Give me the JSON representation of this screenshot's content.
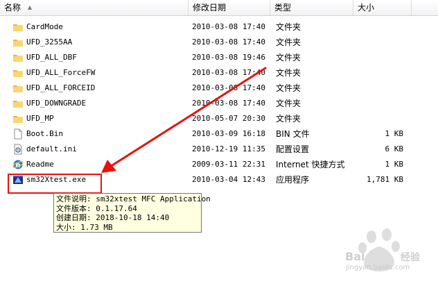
{
  "columns": {
    "name": "名称",
    "date": "修改日期",
    "type": "类型",
    "size": "大小"
  },
  "files": [
    {
      "name": "CardMode",
      "date": "2010-03-08 17:40",
      "type": "文件夹",
      "size": "",
      "icon": "folder"
    },
    {
      "name": "UFD_3255AA",
      "date": "2010-03-08 17:40",
      "type": "文件夹",
      "size": "",
      "icon": "folder"
    },
    {
      "name": "UFD_ALL_DBF",
      "date": "2010-03-08 19:46",
      "type": "文件夹",
      "size": "",
      "icon": "folder"
    },
    {
      "name": "UFD_ALL_ForceFW",
      "date": "2010-03-08 17:40",
      "type": "文件夹",
      "size": "",
      "icon": "folder"
    },
    {
      "name": "UFD_ALL_FORCEID",
      "date": "2010-03-08 17:40",
      "type": "文件夹",
      "size": "",
      "icon": "folder"
    },
    {
      "name": "UFD_DOWNGRADE",
      "date": "2010-03-08 17:40",
      "type": "文件夹",
      "size": "",
      "icon": "folder"
    },
    {
      "name": "UFD_MP",
      "date": "2010-05-07 20:30",
      "type": "文件夹",
      "size": "",
      "icon": "folder"
    },
    {
      "name": "Boot.Bin",
      "date": "2010-03-09 16:18",
      "type": "BIN 文件",
      "size": "1 KB",
      "icon": "file"
    },
    {
      "name": "default.ini",
      "date": "2010-12-19 11:35",
      "type": "配置设置",
      "size": "6 KB",
      "icon": "ini"
    },
    {
      "name": "Readme",
      "date": "2009-03-11 22:31",
      "type": "Internet 快捷方式",
      "size": "1 KB",
      "icon": "ie"
    },
    {
      "name": "sm32Xtest.exe",
      "date": "2010-03-04 12:43",
      "type": "应用程序",
      "size": "1,781 KB",
      "icon": "exe"
    }
  ],
  "tooltip": {
    "line1": "文件说明: sm32xtest MFC Application",
    "line2": "文件版本: 0.1.17.64",
    "line3": "创建日期: 2018-10-18 14:40",
    "line4": "大小: 1.73 MB"
  },
  "watermark": {
    "site": "jingyan.baidu.com"
  },
  "colors": {
    "highlight": "#e8110e",
    "folder": "#f4c94a",
    "tooltip_bg": "#ffffe1"
  }
}
